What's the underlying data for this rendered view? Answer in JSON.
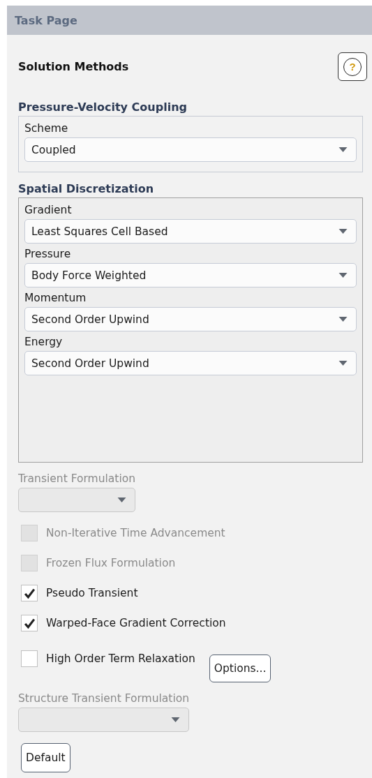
{
  "panel": {
    "title": "Task Page"
  },
  "page_title": "Solution Methods",
  "help_button": {
    "label": "?"
  },
  "groups": [
    {
      "title": "Pressure-Velocity Coupling",
      "fields": [
        {
          "label": "Scheme",
          "value": "Coupled"
        }
      ],
      "tall": false
    },
    {
      "title": "Spatial Discretization",
      "fields": [
        {
          "label": "Gradient",
          "value": "Least Squares Cell Based"
        },
        {
          "label": "Pressure",
          "value": "Body Force Weighted"
        },
        {
          "label": "Momentum",
          "value": "Second Order Upwind"
        },
        {
          "label": "Energy",
          "value": "Second Order Upwind"
        }
      ],
      "tall": true
    }
  ],
  "items": [
    {
      "kind": "dropdown",
      "label": "Transient Formulation",
      "disabled": true
    },
    {
      "kind": "checkbox",
      "label": "Non-Iterative Time Advancement",
      "checked": false,
      "disabled": true
    },
    {
      "kind": "checkbox",
      "label": "Frozen Flux Formulation",
      "checked": false,
      "disabled": true
    },
    {
      "kind": "checkbox",
      "label": "Pseudo Transient",
      "checked": true,
      "disabled": false
    },
    {
      "kind": "checkbox",
      "label": "Warped-Face Gradient Correction",
      "checked": true,
      "disabled": false
    },
    {
      "kind": "checkbox",
      "label": "High Order Term Relaxation",
      "checked": false,
      "disabled": false,
      "button": "Options..."
    },
    {
      "kind": "dropdown",
      "label": "Structure Transient Formulation",
      "disabled": true
    },
    {
      "kind": "button",
      "label": "Default"
    }
  ]
}
